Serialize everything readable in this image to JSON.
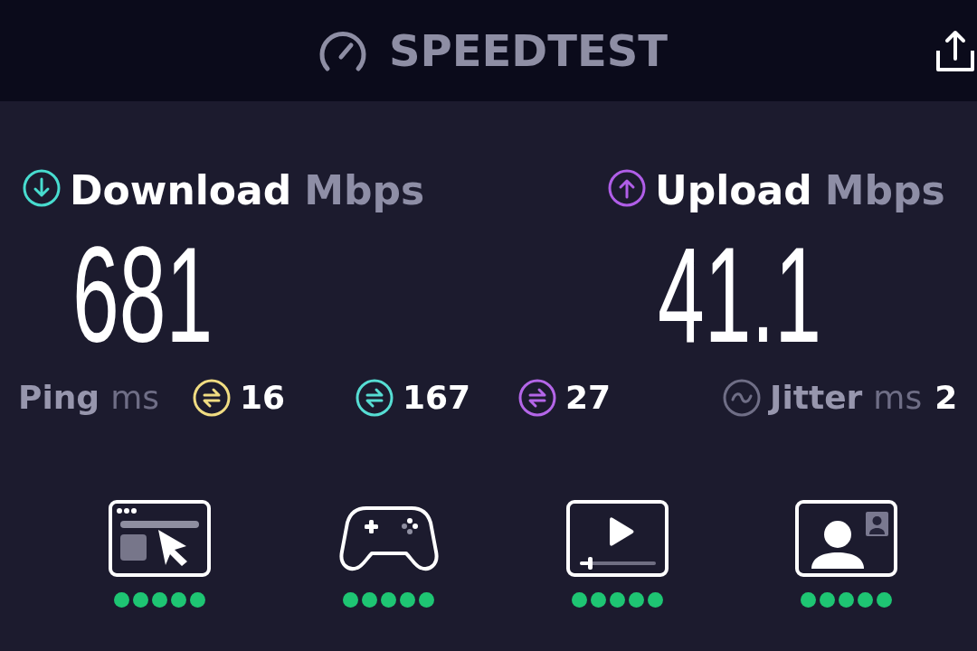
{
  "header": {
    "title": "SPEEDTEST"
  },
  "results": [
    {
      "kind": "download",
      "label": "Download",
      "unit": "Mbps",
      "value": "681",
      "color": "#48dccf"
    },
    {
      "kind": "upload",
      "label": "Upload",
      "unit": "Mbps",
      "value": "41.1",
      "color": "#b05ee8"
    }
  ],
  "ping": {
    "label": "Ping",
    "unit": "ms",
    "readings": [
      {
        "value": "16",
        "color": "#f0dc82"
      },
      {
        "value": "167",
        "color": "#56ddd3"
      },
      {
        "value": "27",
        "color": "#b466e8"
      }
    ]
  },
  "jitter": {
    "label": "Jitter",
    "unit": "ms",
    "value": "2"
  },
  "activities": [
    {
      "kind": "web_browsing",
      "stars": 5
    },
    {
      "kind": "gaming",
      "stars": 5
    },
    {
      "kind": "video_streaming",
      "stars": 5
    },
    {
      "kind": "video_calling",
      "stars": 5
    }
  ]
}
